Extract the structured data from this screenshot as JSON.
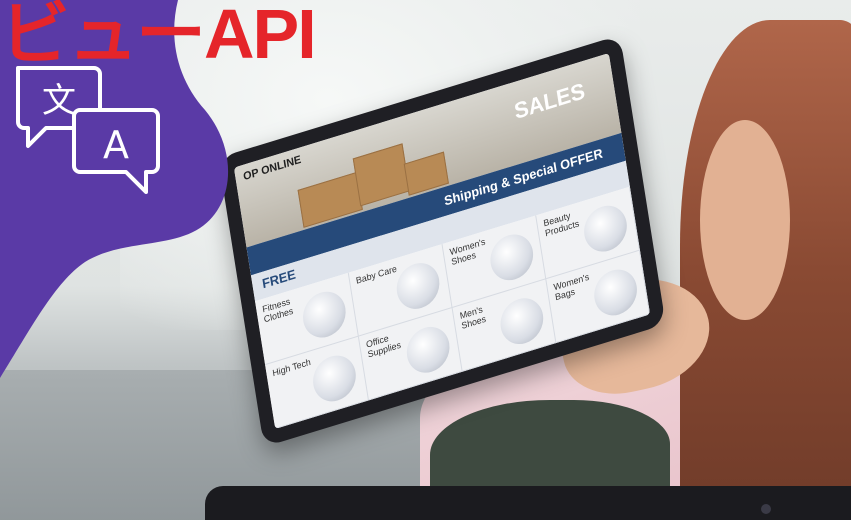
{
  "title": {
    "text": "ビューAPI",
    "color": "#e5252a"
  },
  "badge": {
    "background": "#5a3aa6",
    "icon": "translate-icon"
  },
  "tablet_screen": {
    "header_text": "OP ONLINE",
    "hero_text": "SALES",
    "offer_text": "Shipping & Special OFFER",
    "free_text": "FREE",
    "categories": [
      "Fitness Clothes",
      "Baby Care",
      "Women's Shoes",
      "Beauty Products",
      "High Tech",
      "Office Supplies",
      "Men's Shoes",
      "Women's Bags"
    ]
  }
}
